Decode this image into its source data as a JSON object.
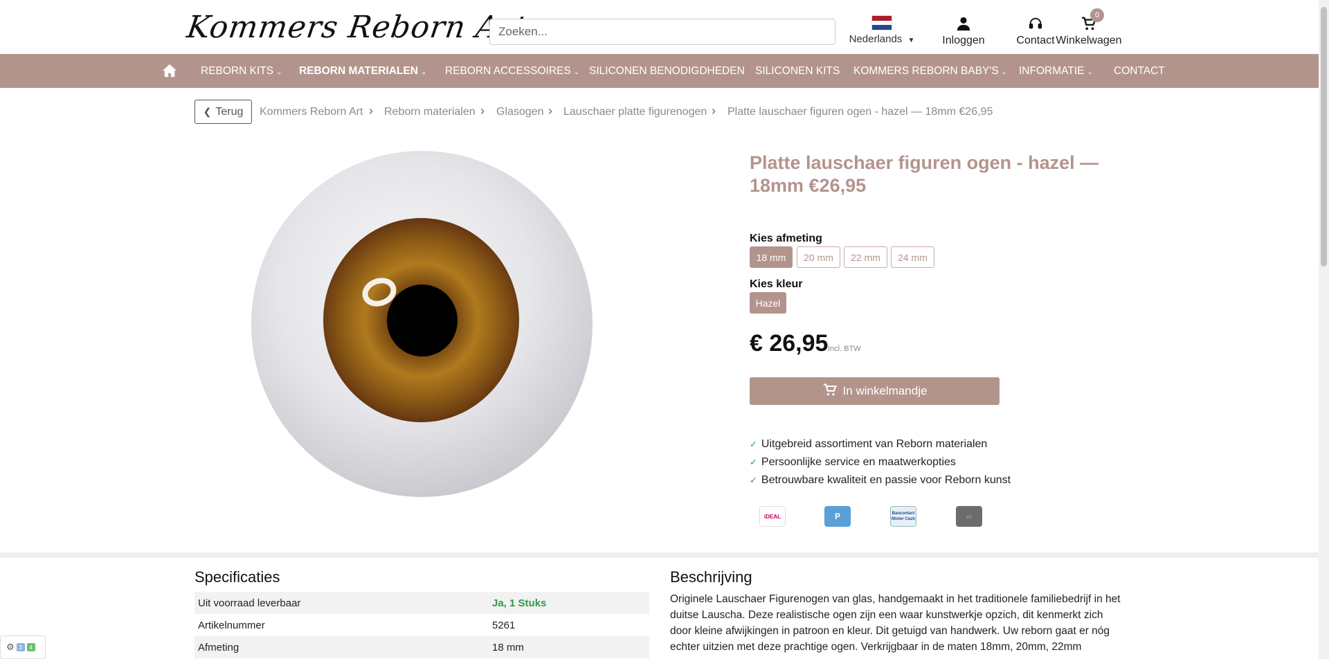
{
  "header": {
    "logo_text": "Kommers Reborn Art",
    "search_placeholder": "Zoeken...",
    "language": "Nederlands",
    "login_label": "Inloggen",
    "contact_label": "Contact",
    "cart_label": "Winkelwagen",
    "cart_count": "0"
  },
  "nav": {
    "items": [
      {
        "label": "REBORN KITS"
      },
      {
        "label": "REBORN MATERIALEN"
      },
      {
        "label": "REBORN ACCESSOIRES"
      },
      {
        "label": "SILICONEN BENODIGDHEDEN"
      },
      {
        "label": "SILICONEN KITS"
      },
      {
        "label": "KOMMERS REBORN BABY'S"
      },
      {
        "label": "INFORMATIE"
      },
      {
        "label": "CONTACT"
      }
    ]
  },
  "breadcrumb": {
    "back_label": "Terug",
    "items": [
      "Kommers Reborn Art",
      "Reborn materialen",
      "Glasogen",
      "Lauschaer platte figurenogen",
      "Platte lauschaer figuren ogen - hazel — 18mm €26,95"
    ]
  },
  "product": {
    "title": "Platte lauschaer figuren ogen - hazel — 18mm €26,95",
    "size_label": "Kies afmeting",
    "sizes": [
      "18 mm",
      "20 mm",
      "22 mm",
      "24 mm"
    ],
    "color_label": "Kies kleur",
    "color": "Hazel",
    "price": "€ 26,95",
    "vat_note": "Incl. BTW",
    "add_to_cart": "In winkelmandje",
    "usps": [
      "Uitgebreid assortiment van Reborn materialen",
      "Persoonlijke service en maatwerkopties",
      "Betrouwbare kwaliteit en passie voor Reborn kunst"
    ],
    "payment_methods": [
      "iDEAL",
      "P",
      "Bancontact Mister Cash",
      "card"
    ]
  },
  "specs": {
    "title": "Specificaties",
    "rows": [
      {
        "label": "Uit voorraad leverbaar",
        "value": "Ja, 1 Stuks"
      },
      {
        "label": "Artikelnummer",
        "value": "5261"
      },
      {
        "label": "Afmeting",
        "value": "18 mm"
      }
    ]
  },
  "description": {
    "title": "Beschrijving",
    "text": "Originele Lauschaer Figurenogen van glas, handgemaakt in het traditionele familiebedrijf in het duitse Lauscha. Deze realistische ogen zijn een waar kunstwerkje opzich, dit kenmerkt zich door kleine afwijkingen in patroon en kleur. Dit getuigd van handwerk. Uw reborn gaat er nóg echter uitzien met deze prachtige ogen. Verkrijgbaar in de maten 18mm, 20mm, 22mm"
  },
  "widget": {
    "badge1": "3",
    "badge2": "4"
  },
  "colors": {
    "accent": "#b3948d",
    "success": "#2e9a45"
  }
}
